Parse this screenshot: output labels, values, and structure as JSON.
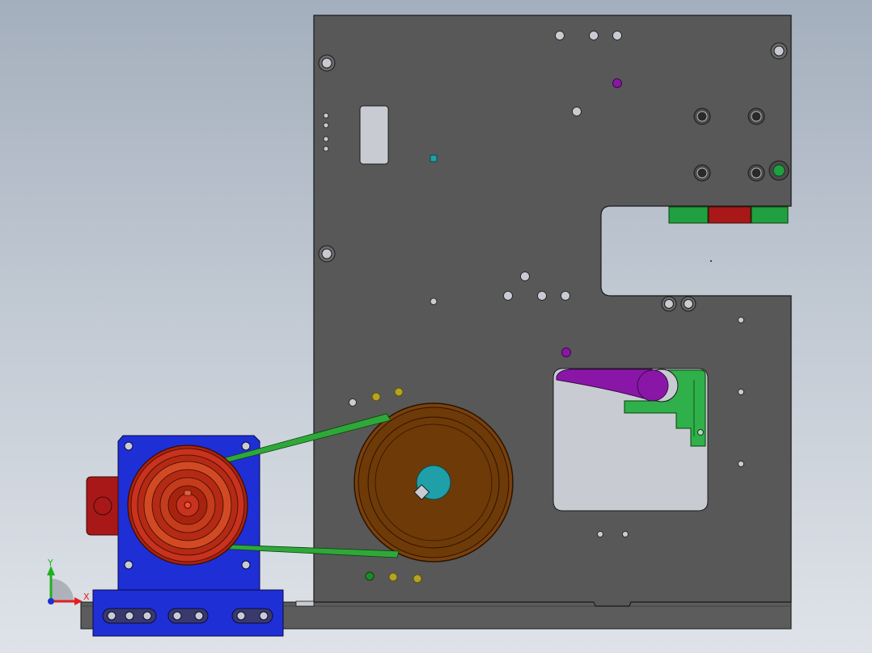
{
  "window": {
    "view": "front-orthographic",
    "background_top": "#a4afbd",
    "background_bottom": "#dfe3e9"
  },
  "triad": {
    "x_label": "X",
    "y_label": "Y",
    "x_color": "#e02020",
    "y_color": "#20b020",
    "z_color": "#2030d0"
  },
  "model": {
    "plate_color": "#585858",
    "cutout_color": "#c8ccd2",
    "motor_mount_color": "#1f2fd6",
    "motor_pulley_color": "#c8321e",
    "driven_pulley_color": "#6e3a08",
    "belt_color": "#2fa83a",
    "hub_color": "#1fa0a8",
    "clamp_color": "#8a16a8",
    "bracket_color": "#2fb04a",
    "red_block_color": "#a81818",
    "green_block_color": "#20a040",
    "pin_yellow_color": "#b4a422",
    "pin_green_color": "#208a2a"
  }
}
